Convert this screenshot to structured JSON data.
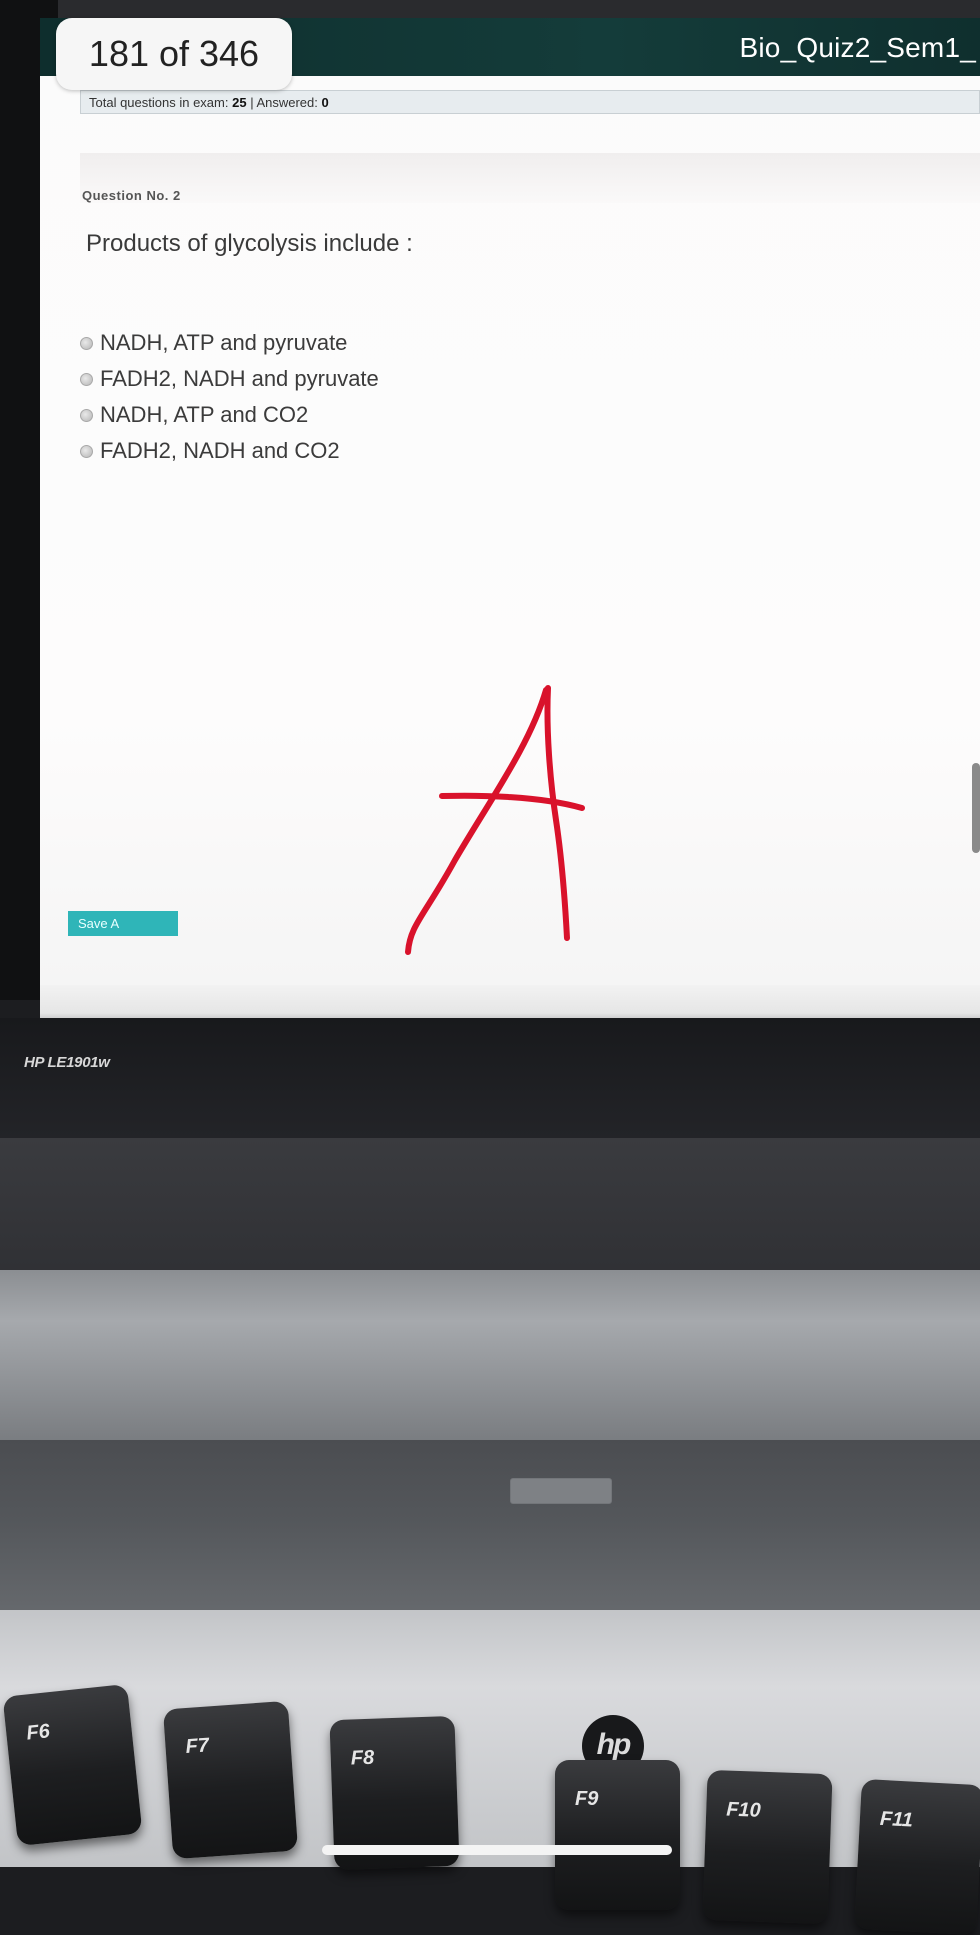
{
  "overlay": {
    "page_counter": "181 of 346"
  },
  "exam": {
    "title": "Bio_Quiz2_Sem1_",
    "stats": {
      "total_label": "Total questions in exam:",
      "total_value": "25",
      "answered_label": "| Answered:",
      "answered_value": "0"
    },
    "question_number": "Question No. 2",
    "question_text": "Products of glycolysis include :",
    "options": [
      "NADH, ATP and pyruvate",
      "FADH2, NADH and pyruvate",
      "NADH, ATP and CO2",
      "FADH2, NADH and CO2"
    ],
    "save_button_label": "Save A"
  },
  "annotation": {
    "handwritten_letter": "A",
    "color": "#d9122b"
  },
  "hardware": {
    "monitor_model": "HP LE1901w",
    "keyboard_brand": "hp",
    "function_keys": [
      "F6",
      "F7",
      "F8",
      "F9",
      "F10",
      "F11"
    ]
  }
}
